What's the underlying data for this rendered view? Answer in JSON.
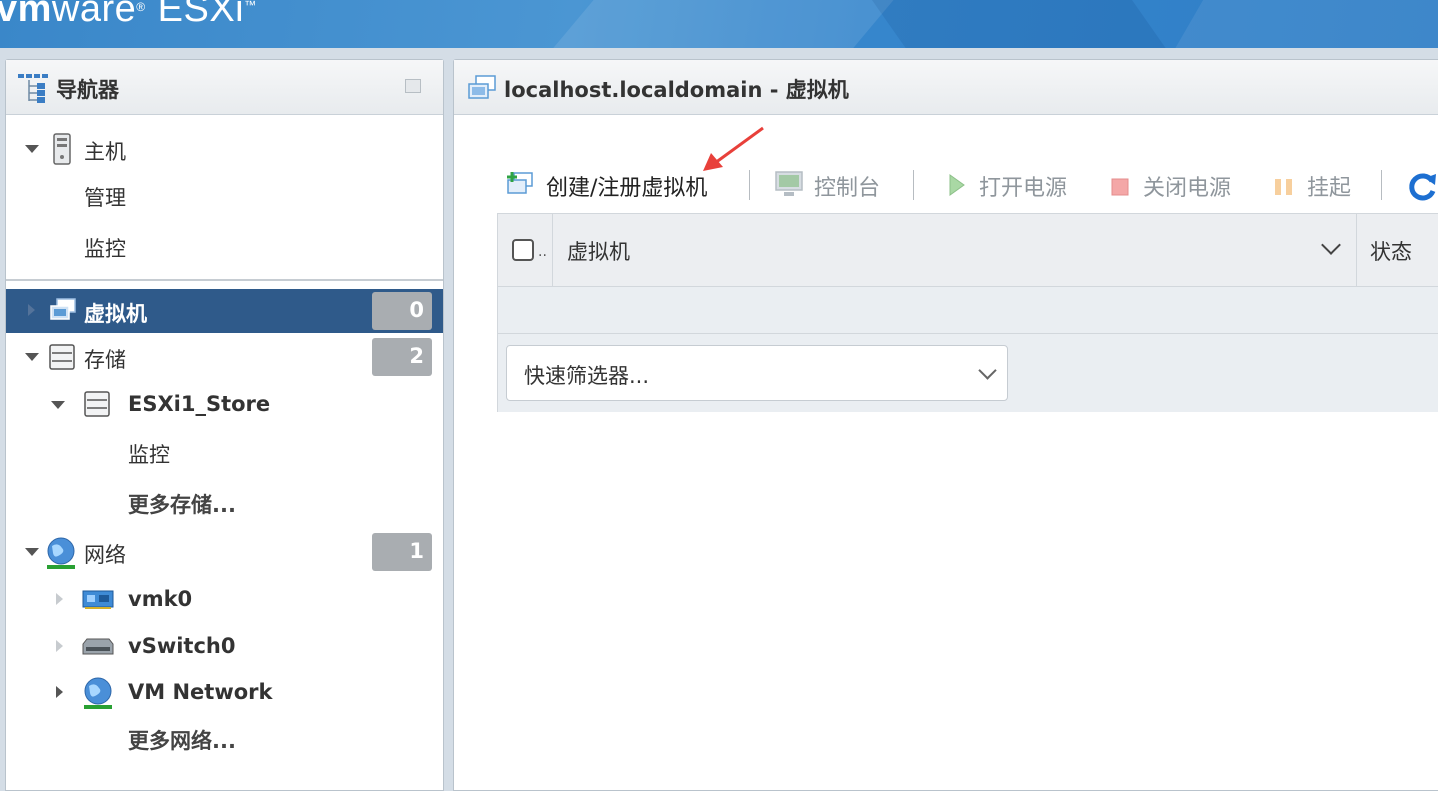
{
  "brand": {
    "vm": "vm",
    "ware": "ware",
    "reg": "®",
    "product": "ESXi",
    "tm": "™"
  },
  "navigator": {
    "title": "导航器",
    "host": {
      "label": "主机",
      "children": [
        "管理",
        "监控"
      ]
    },
    "vms": {
      "label": "虚拟机",
      "count": "0"
    },
    "storage": {
      "label": "存储",
      "count": "2",
      "datastore": {
        "label": "ESXi1_Store",
        "children": [
          "监控"
        ]
      },
      "more": "更多存储..."
    },
    "network": {
      "label": "网络",
      "count": "1",
      "items": [
        "vmk0",
        "vSwitch0",
        "VM Network"
      ],
      "more": "更多网络..."
    }
  },
  "main": {
    "title": "localhost.localdomain - 虚拟机",
    "toolbar": {
      "create": "创建/注册虚拟机",
      "console": "控制台",
      "power_on": "打开电源",
      "power_off": "关闭电源",
      "suspend": "挂起"
    },
    "grid": {
      "columns": [
        "虚拟机",
        "状态"
      ],
      "checkbox_ellipsis": "..",
      "filter_placeholder": "快速筛选器..."
    }
  },
  "colors": {
    "selected_row": "#2f5a8a",
    "badge": "#a9adb1",
    "annotation_arrow": "#e8403a",
    "banner": "#3a87c9"
  }
}
